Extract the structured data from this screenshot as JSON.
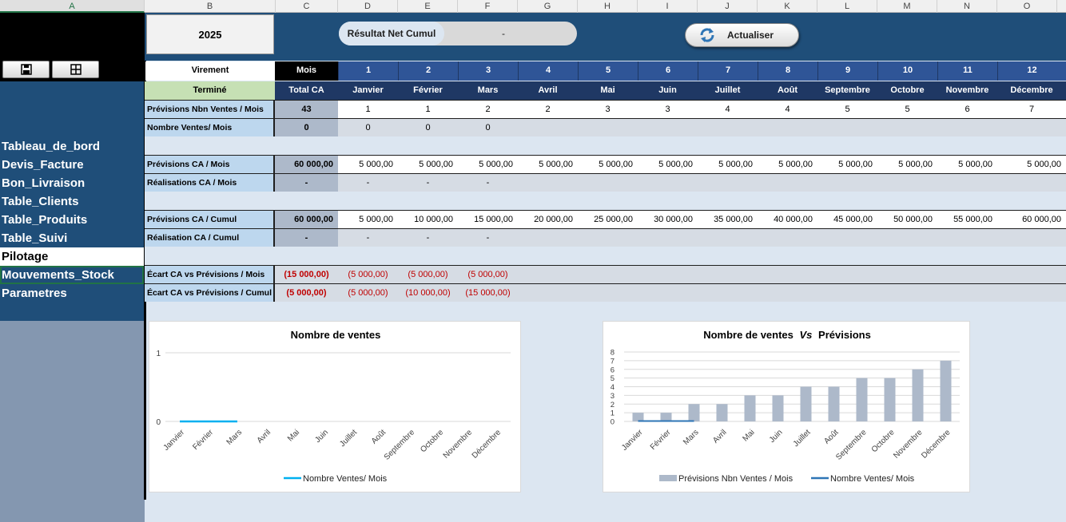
{
  "columns": [
    "A",
    "B",
    "C",
    "D",
    "E",
    "F",
    "G",
    "H",
    "I",
    "J",
    "K",
    "L",
    "M",
    "N",
    "O"
  ],
  "header": {
    "year": "2025",
    "result_label": "Résultat Net Cumul",
    "result_value": "-",
    "refresh_label": "Actualiser"
  },
  "nav": {
    "items": [
      "Tableau_de_bord",
      "Devis_Facture",
      "Bon_Livraison",
      "Table_Clients",
      "Table_Produits",
      "Table_Suivi",
      "Pilotage",
      "Mouvements_Stock",
      "Parametres"
    ],
    "active": "Pilotage"
  },
  "table": {
    "row_virement": {
      "label": "Virement",
      "mois": "Mois",
      "numbers": [
        "1",
        "2",
        "3",
        "4",
        "5",
        "6",
        "7",
        "8",
        "9",
        "10",
        "11",
        "12"
      ]
    },
    "row_months": {
      "label": "Terminé",
      "total": "Total CA",
      "months": [
        "Janvier",
        "Février",
        "Mars",
        "Avril",
        "Mai",
        "Juin",
        "Juillet",
        "Août",
        "Septembre",
        "Octobre",
        "Novembre",
        "Décembre"
      ]
    },
    "rows": [
      {
        "label": "Prévisions Nbn Ventes / Mois",
        "total": "43",
        "values": [
          "1",
          "1",
          "2",
          "2",
          "3",
          "3",
          "4",
          "4",
          "5",
          "5",
          "6",
          "7"
        ],
        "style": "white"
      },
      {
        "label": "Nombre Ventes/ Mois",
        "total": "0",
        "values": [
          "0",
          "0",
          "0",
          "",
          "",
          "",
          "",
          "",
          "",
          "",
          "",
          ""
        ],
        "style": "grey"
      },
      {
        "label": "Prévisions CA / Mois",
        "total": "60 000,00",
        "values": [
          "5 000,00",
          "5 000,00",
          "5 000,00",
          "5 000,00",
          "5 000,00",
          "5 000,00",
          "5 000,00",
          "5 000,00",
          "5 000,00",
          "5 000,00",
          "5 000,00",
          "5 000,00"
        ],
        "style": "white"
      },
      {
        "label": "Réalisations CA / Mois",
        "total": "-",
        "values": [
          "-",
          "-",
          "-",
          "",
          "",
          "",
          "",
          "",
          "",
          "",
          "",
          ""
        ],
        "style": "grey"
      },
      {
        "label": "Prévisions CA / Cumul",
        "total": "60 000,00",
        "values": [
          "5 000,00",
          "10 000,00",
          "15 000,00",
          "20 000,00",
          "25 000,00",
          "30 000,00",
          "35 000,00",
          "40 000,00",
          "45 000,00",
          "50 000,00",
          "55 000,00",
          "60 000,00"
        ],
        "style": "white"
      },
      {
        "label": "Réalisation CA / Cumul",
        "total": "-",
        "values": [
          "-",
          "-",
          "-",
          "",
          "",
          "",
          "",
          "",
          "",
          "",
          "",
          ""
        ],
        "style": "grey"
      },
      {
        "label": "Écart CA vs Prévisions / Mois",
        "total": "(15 000,00)",
        "values": [
          "(5 000,00)",
          "(5 000,00)",
          "(5 000,00)",
          "",
          "",
          "",
          "",
          "",
          "",
          "",
          "",
          ""
        ],
        "style": "red"
      },
      {
        "label": "Écart CA vs Prévisions / Cumul",
        "total": "(5 000,00)",
        "values": [
          "(5 000,00)",
          "(10 000,00)",
          "(15 000,00)",
          "",
          "",
          "",
          "",
          "",
          "",
          "",
          "",
          ""
        ],
        "style": "red"
      }
    ]
  },
  "chart_data": [
    {
      "type": "line",
      "title": "Nombre de ventes",
      "categories": [
        "Janvier",
        "Février",
        "Mars",
        "Avril",
        "Mai",
        "Juin",
        "Juillet",
        "Août",
        "Septembre",
        "Octobre",
        "Novembre",
        "Décembre"
      ],
      "series": [
        {
          "name": "Nombre Ventes/ Mois",
          "values": [
            0,
            0,
            0,
            null,
            null,
            null,
            null,
            null,
            null,
            null,
            null,
            null
          ]
        }
      ],
      "ylim": [
        0,
        1
      ],
      "yticks": [
        "0",
        "1"
      ],
      "legend": "bottom",
      "color": "#00b0f0"
    },
    {
      "type": "bar",
      "title": "Nombre de ventes",
      "title_vs": "Vs",
      "title_end": "Prévisions",
      "categories": [
        "Janvier",
        "Février",
        "Mars",
        "Avril",
        "Mai",
        "Juin",
        "Juillet",
        "Août",
        "Septembre",
        "Octobre",
        "Novembre",
        "Décembre"
      ],
      "series": [
        {
          "name": "Prévisions Nbn Ventes / Mois",
          "values": [
            1,
            1,
            2,
            2,
            3,
            3,
            4,
            4,
            5,
            5,
            6,
            7
          ]
        },
        {
          "name": "Nombre Ventes/ Mois",
          "values": [
            0,
            0,
            0,
            null,
            null,
            null,
            null,
            null,
            null,
            null,
            null,
            null
          ]
        }
      ],
      "ylim": [
        0,
        8
      ],
      "yticks": [
        "0",
        "1",
        "2",
        "3",
        "4",
        "5",
        "6",
        "7",
        "8"
      ],
      "legend": "bottom",
      "bar_color": "#adb9ca",
      "line_color": "#2e75b6"
    }
  ]
}
